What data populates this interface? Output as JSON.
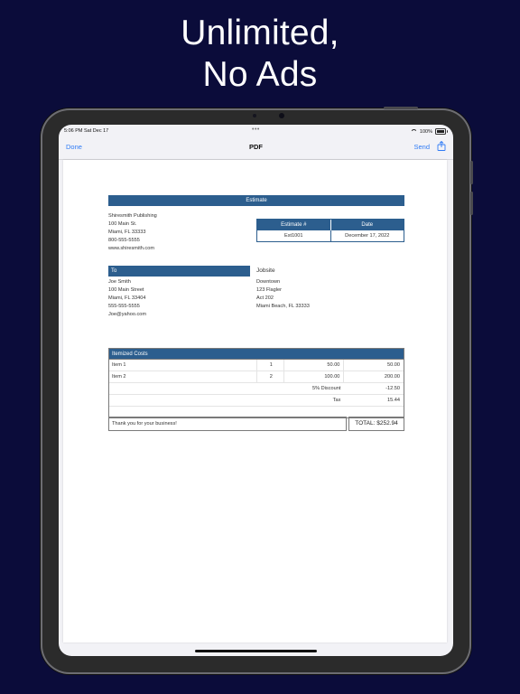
{
  "promo": {
    "line1": "Unlimited,",
    "line2": "No Ads"
  },
  "status_bar": {
    "time": "5:06 PM  Sat Dec 17",
    "dots": "•••",
    "battery": "100%"
  },
  "nav": {
    "done": "Done",
    "title": "PDF",
    "send": "Send"
  },
  "estimate": {
    "heading": "Estimate",
    "company_lines": [
      "Shiresmith Publishing",
      "100 Main St.",
      "Miami, FL  33333",
      "800-555-5555",
      "www.shiresmith.com"
    ],
    "est_header": "Estimate #",
    "date_header": "Date",
    "est_number": "Est1001",
    "date": "December 17, 2022",
    "to_label": "To",
    "to_lines": [
      "Joe Smith",
      "100 Main Street",
      "Miami, FL  33404",
      "555-555-5555",
      "Joe@yahoo.com"
    ],
    "jobsite_label": "Jobsite",
    "jobsite_lines": [
      "Downtown",
      "123 Flagler",
      "Act 202",
      "Miami Beach, FL  33333"
    ],
    "items_header": "Itemized Costs",
    "items": [
      {
        "desc": "Item 1",
        "qty": "1",
        "price": "50.00",
        "total": "50.00"
      },
      {
        "desc": "Item 2",
        "qty": "2",
        "price": "100.00",
        "total": "200.00"
      }
    ],
    "discount_label": "5% Discount",
    "discount_value": "-12.50",
    "tax_label": "Tax",
    "tax_value": "15.44",
    "thanks": "Thank you for your business!",
    "total": "TOTAL: $252.94"
  },
  "colors": {
    "background": "#0b0c3a",
    "header_bar": "#2c5e8e",
    "link": "#2f7bf5"
  }
}
